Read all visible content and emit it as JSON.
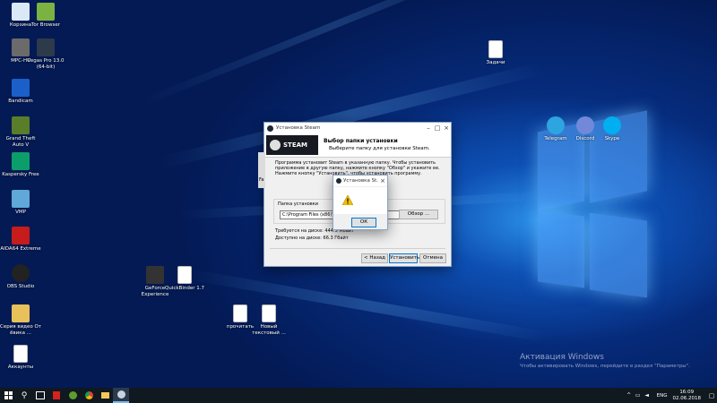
{
  "desktop": {
    "icons": [
      {
        "label": "Корзина",
        "icon": "recycle-bin-icon",
        "color": "#dbe8f5"
      },
      {
        "label": "Tor Browser",
        "icon": "tor-browser-icon",
        "color": "#7ab342"
      },
      {
        "label": "MPC-HC",
        "icon": "mpc-hc-icon",
        "color": "#6b6b6b"
      },
      {
        "label": "Vegas Pro 13.0 (64-bit)",
        "icon": "vegas-icon",
        "color": "#2d3a4a"
      },
      {
        "label": "Bandicam",
        "icon": "bandicam-icon",
        "color": "#1b60c9"
      },
      {
        "label": "Grand Theft Auto V",
        "icon": "gta-icon",
        "color": "#5a7d2a"
      },
      {
        "label": "Kaspersky Free",
        "icon": "kaspersky-icon",
        "color": "#0c9e6a"
      },
      {
        "label": "VMP",
        "icon": "vmp-icon",
        "color": "#5fa8d8"
      },
      {
        "label": "AIDA64 Extreme",
        "icon": "aida64-icon",
        "color": "#c61c1c"
      },
      {
        "label": "OBS Studio",
        "icon": "obs-icon",
        "color": "#222222"
      },
      {
        "label": "Серия видео От ёвика ...",
        "icon": "folder-icon",
        "color": "#e8c15a"
      },
      {
        "label": "Аккаунты",
        "icon": "file-icon",
        "color": "#ffffff"
      },
      {
        "label": "GeForce Experience",
        "icon": "geforce-icon",
        "color": "#333333"
      },
      {
        "label": "QuickBinder 1.7",
        "icon": "file-icon",
        "color": "#ffffff"
      },
      {
        "label": "прочитать",
        "icon": "file-icon",
        "color": "#ffffff"
      },
      {
        "label": "Новый текстовый ...",
        "icon": "file-icon",
        "color": "#ffffff"
      },
      {
        "label": "Задачи",
        "icon": "file-icon",
        "color": "#ffffff"
      },
      {
        "label": "Telegram",
        "icon": "telegram-icon",
        "color": "#2ca5e0"
      },
      {
        "label": "Discord",
        "icon": "discord-icon",
        "color": "#7289da"
      },
      {
        "label": "Skype",
        "icon": "skype-icon",
        "color": "#00aff0"
      }
    ]
  },
  "installer": {
    "title": "Установка Steam",
    "header_title": "Выбор папки установки",
    "header_subtitle": "Выберите папку для установки Steam.",
    "logo_text": "STEAM",
    "description": "Программа установит Steam в указанную папку. Чтобы установить приложение в другую папку, нажмите кнопку \"Обзор\" и укажите ее. Нажмите кнопку \"Установить\", чтобы установить программу.",
    "folder_group_label": "Папка установки",
    "folder_path": "C:\\Program Files (x86)\\Steam",
    "browse_label": "Обзор ...",
    "space_required": "Требуется на диске: 444.5 Мбайт",
    "space_available": "Доступно на диске: 66.3 Гбайт",
    "back_label": "< Назад",
    "install_label": "Установить",
    "cancel_label": "Отмена",
    "sidebar_label": "Fa"
  },
  "alert": {
    "title": "Установка St...",
    "ok_label": "ОК"
  },
  "activation": {
    "title": "Активация Windows",
    "subtitle": "Чтобы активировать Windows, перейдите в раздел \"Параметры\"."
  },
  "taskbar": {
    "language": "ENG",
    "time": "16:09",
    "date": "02.06.2018"
  }
}
